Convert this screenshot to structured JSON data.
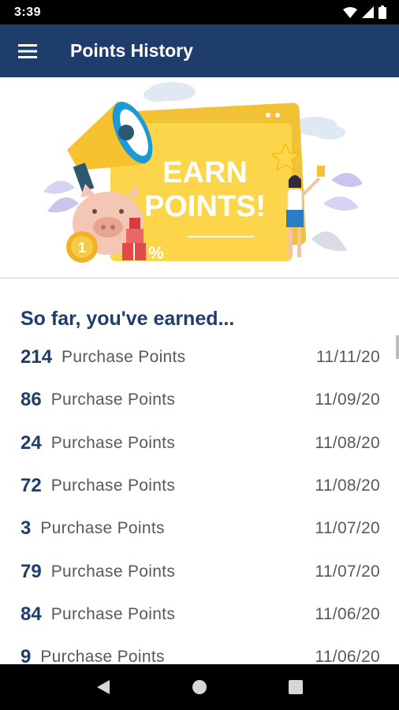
{
  "status_bar": {
    "time": "3:39",
    "icons": [
      "wifi-icon",
      "signal-icon",
      "battery-icon"
    ]
  },
  "app_bar": {
    "title": "Points History",
    "menu_icon": "hamburger-menu-icon",
    "background_color": "#1f3d6b"
  },
  "banner": {
    "line1": "EARN",
    "line2": "POINTS!",
    "coin_label": "1",
    "discount_label": "%"
  },
  "history": {
    "heading": "So far, you've earned...",
    "items": [
      {
        "points": "214",
        "label": "Purchase Points",
        "date": "11/11/20"
      },
      {
        "points": "86",
        "label": "Purchase Points",
        "date": "11/09/20"
      },
      {
        "points": "24",
        "label": "Purchase Points",
        "date": "11/08/20"
      },
      {
        "points": "72",
        "label": "Purchase Points",
        "date": "11/08/20"
      },
      {
        "points": "3",
        "label": "Purchase Points",
        "date": "11/07/20"
      },
      {
        "points": "79",
        "label": "Purchase Points",
        "date": "11/07/20"
      },
      {
        "points": "84",
        "label": "Purchase Points",
        "date": "11/06/20"
      },
      {
        "points": "9",
        "label": "Purchase Points",
        "date": "11/06/20"
      }
    ]
  },
  "nav_bar": {
    "buttons": [
      "back-icon",
      "home-icon",
      "recents-icon"
    ]
  }
}
